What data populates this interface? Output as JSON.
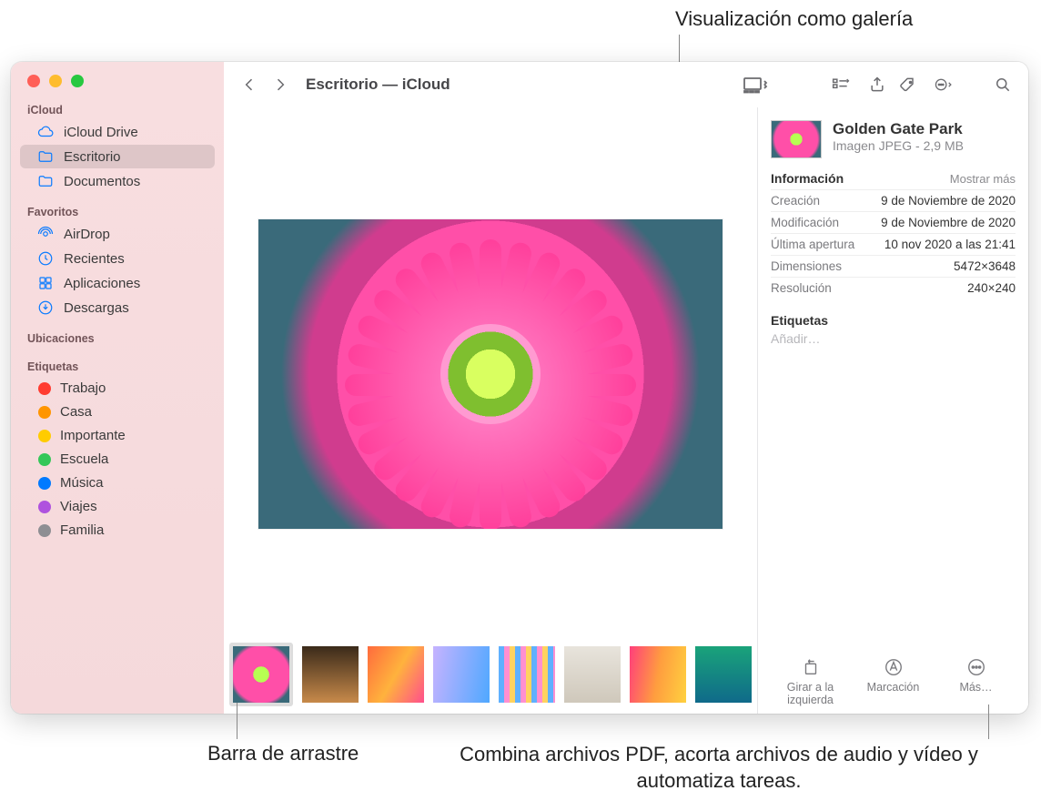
{
  "callouts": {
    "top": "Visualización como galería",
    "left": "Barra de arrastre",
    "right": "Combina archivos PDF, acorta archivos de audio y vídeo y automatiza tareas."
  },
  "toolbar": {
    "title": "Escritorio — iCloud"
  },
  "sidebar": {
    "sections": {
      "icloud": {
        "header": "iCloud",
        "items": [
          "iCloud Drive",
          "Escritorio",
          "Documentos"
        ]
      },
      "favorites": {
        "header": "Favoritos",
        "items": [
          "AirDrop",
          "Recientes",
          "Aplicaciones",
          "Descargas"
        ]
      },
      "locations": {
        "header": "Ubicaciones"
      },
      "tags": {
        "header": "Etiquetas",
        "items": [
          {
            "label": "Trabajo",
            "color": "#ff3b30"
          },
          {
            "label": "Casa",
            "color": "#ff9500"
          },
          {
            "label": "Importante",
            "color": "#ffcc00"
          },
          {
            "label": "Escuela",
            "color": "#34c759"
          },
          {
            "label": "Música",
            "color": "#007aff"
          },
          {
            "label": "Viajes",
            "color": "#af52de"
          },
          {
            "label": "Familia",
            "color": "#8e8e93"
          }
        ]
      }
    }
  },
  "inspector": {
    "title": "Golden Gate Park",
    "subtitle": "Imagen JPEG - 2,9 MB",
    "info_header": "Información",
    "show_more": "Mostrar más",
    "rows": [
      {
        "key": "Creación",
        "val": "9 de Noviembre de 2020"
      },
      {
        "key": "Modificación",
        "val": "9 de Noviembre de 2020"
      },
      {
        "key": "Última apertura",
        "val": "10 nov 2020 a las 21:41"
      },
      {
        "key": "Dimensiones",
        "val": "5472×3648"
      },
      {
        "key": "Resolución",
        "val": "240×240"
      }
    ],
    "tags_header": "Etiquetas",
    "tags_placeholder": "Añadir…"
  },
  "quick_actions": {
    "rotate": "Girar a la izquierda",
    "markup": "Marcación",
    "more": "Más…"
  },
  "thumbnails": [
    "t0",
    "t1",
    "t2",
    "t3",
    "t4",
    "t5",
    "t6",
    "t7"
  ]
}
